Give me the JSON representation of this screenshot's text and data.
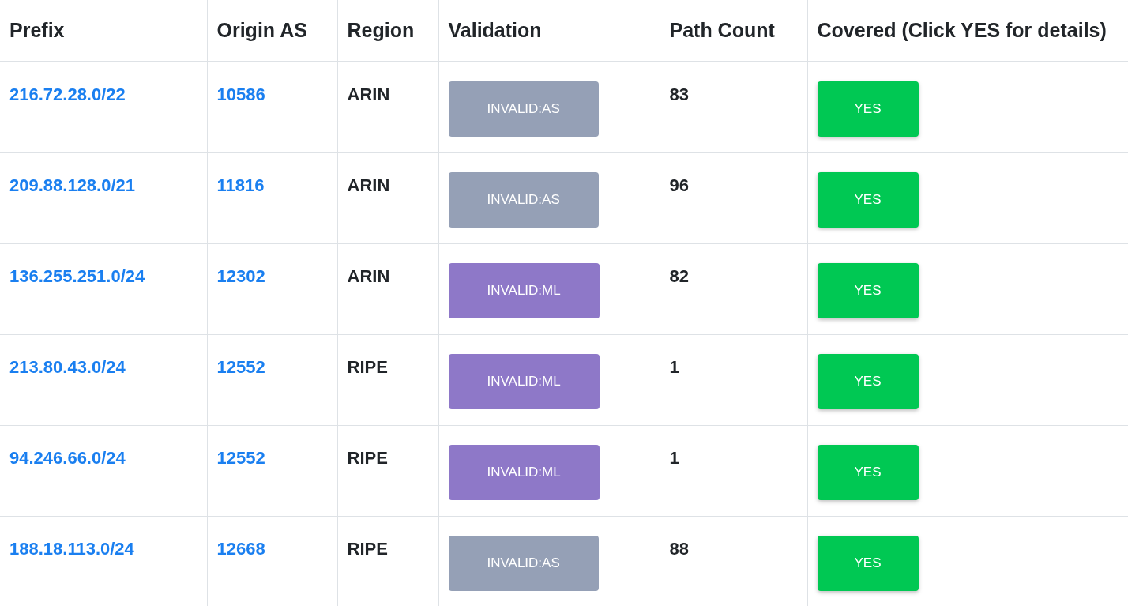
{
  "table": {
    "columns": [
      "Prefix",
      "Origin AS",
      "Region",
      "Validation",
      "Path Count",
      "Covered (Click YES for details)"
    ],
    "rows": [
      {
        "prefix": "216.72.28.0/22",
        "origin_as": "10586",
        "region": "ARIN",
        "validation": {
          "label": "INVALID:AS",
          "color": "#95a0b6"
        },
        "path_count": "83",
        "covered": "YES"
      },
      {
        "prefix": "209.88.128.0/21",
        "origin_as": "11816",
        "region": "ARIN",
        "validation": {
          "label": "INVALID:AS",
          "color": "#95a0b6"
        },
        "path_count": "96",
        "covered": "YES"
      },
      {
        "prefix": "136.255.251.0/24",
        "origin_as": "12302",
        "region": "ARIN",
        "validation": {
          "label": "INVALID:ML",
          "color": "#8e78c8"
        },
        "path_count": "82",
        "covered": "YES"
      },
      {
        "prefix": "213.80.43.0/24",
        "origin_as": "12552",
        "region": "RIPE",
        "validation": {
          "label": "INVALID:ML",
          "color": "#8e78c8"
        },
        "path_count": "1",
        "covered": "YES"
      },
      {
        "prefix": "94.246.66.0/24",
        "origin_as": "12552",
        "region": "RIPE",
        "validation": {
          "label": "INVALID:ML",
          "color": "#8e78c8"
        },
        "path_count": "1",
        "covered": "YES"
      },
      {
        "prefix": "188.18.113.0/24",
        "origin_as": "12668",
        "region": "RIPE",
        "validation": {
          "label": "INVALID:AS",
          "color": "#95a0b6"
        },
        "path_count": "88",
        "covered": "YES"
      }
    ]
  }
}
